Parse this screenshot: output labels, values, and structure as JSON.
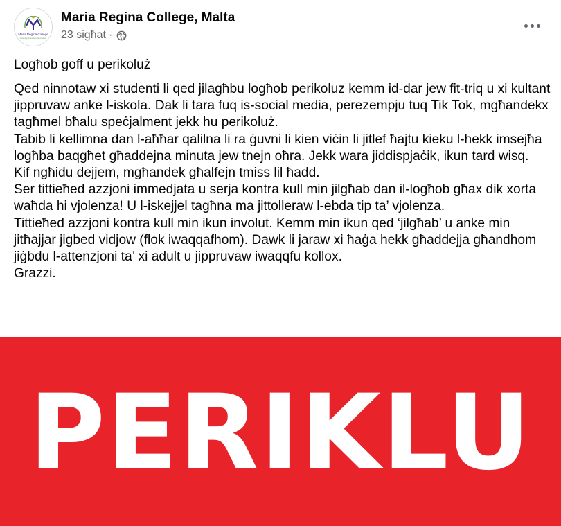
{
  "header": {
    "page_name": "Maria Regina College, Malta",
    "timestamp": "23 sigħat",
    "separator": "·",
    "logo_text": "Maria Regina College",
    "logo_subtext": "Learning, Innovation, Excellence"
  },
  "post": {
    "title": "Logħob goff u perikoluż",
    "paragraphs": [
      "Qed ninnotaw xi studenti li qed jilagħbu logħob perikoluz kemm id-dar jew fit-triq u xi kultant jippruvaw anke l-iskola. Dak li tara fuq is-social media, perezempju tuq Tik Tok, mgħandekx tagħmel bħalu speċjalment jekk hu perikoluż.",
      "Tabib li kellimna dan l-aħħar qalilna li ra ġuvni li kien viċin li jitlef ħajtu kieku l-hekk imsejħa logħba baqgħet għaddejna minuta jew tnejn oħra. Jekk wara jiddispjaċik, ikun tard wisq.",
      "Kif ngħidu dejjem, mgħandek għalfejn tmiss lil ħadd.",
      "Ser tittieħed azzjoni immedjata u serja kontra kull min jilgħab dan il-logħob għax dik xorta waħda hi vjolenza! U l-iskejjel tagħna ma jittolleraw l-ebda tip ta’ vjolenza.",
      "Tittieħed azzjoni kontra kull min ikun involut. Kemm min ikun qed ‘jilgħab’ u anke min jitħajjar jigbed vidjow (flok iwaqqafhom). Dawk li jaraw xi ħaġa hekk għaddejja għandhom jiġbdu l-attenzjoni ta’ xi adult u jippruvaw iwaqqfu kollox.",
      "Grazzi."
    ]
  },
  "banner": {
    "text": "PERIKLU",
    "background_color": "#e8232a",
    "text_color": "#ffffff"
  },
  "icons": {
    "globe": "globe-icon",
    "more": "more-options-icon"
  }
}
